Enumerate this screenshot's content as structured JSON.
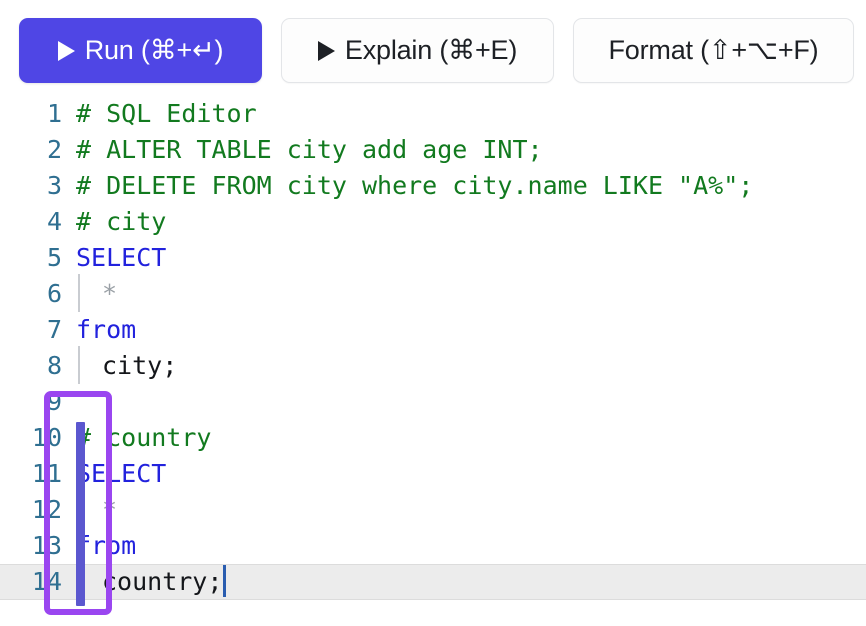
{
  "toolbar": {
    "run": {
      "label": "Run (⌘+↵)",
      "icon": "play-triangle-icon",
      "accent": "#4f46e5"
    },
    "explain": {
      "label": "Explain (⌘+E)",
      "icon": "play-triangle-icon"
    },
    "format": {
      "label": "Format (⇧+⌥+F)"
    }
  },
  "editor": {
    "language": "sql",
    "active_line": 14,
    "cursor_line": 14,
    "cursor_column": 11,
    "colors": {
      "comment": "#127a1f",
      "keyword": "#2222dd",
      "operator": "#9aa0a6",
      "plain": "#14161a",
      "line_number": "#2f6f91",
      "active_line_bg": "#ececec",
      "caret": "#2a5db0",
      "change_bar": "#5b57cf",
      "annotation": "#9a46f0"
    },
    "lines": [
      {
        "n": "1",
        "text": "# SQL Editor"
      },
      {
        "n": "2",
        "text": "# ALTER TABLE city add age INT;"
      },
      {
        "n": "3",
        "text": "# DELETE FROM city where city.name LIKE \"A%\";"
      },
      {
        "n": "4",
        "text": "# city"
      },
      {
        "n": "5",
        "text": "SELECT"
      },
      {
        "n": "6",
        "text": "  *"
      },
      {
        "n": "7",
        "text": "from"
      },
      {
        "n": "8",
        "text": "  city;"
      },
      {
        "n": "9",
        "text": ""
      },
      {
        "n": "10",
        "text": "# country"
      },
      {
        "n": "11",
        "text": "SELECT"
      },
      {
        "n": "12",
        "text": "  *"
      },
      {
        "n": "13",
        "text": "from"
      },
      {
        "n": "14",
        "text": "  country;"
      }
    ],
    "tokens": {
      "l1_comment": "# SQL Editor",
      "l2_comment": "# ALTER TABLE city add age INT;",
      "l3_comment": "# DELETE FROM city where city.name LIKE \"A%\";",
      "l4_comment": "# city",
      "l5_keyword": "SELECT",
      "l6_star": "*",
      "l7_keyword": "from",
      "l8_plain": "city;",
      "l9_empty": "",
      "l10_comment": "# country",
      "l11_keyword": "SELECT",
      "l12_star": "*",
      "l13_keyword": "from",
      "l14_plain": "country;"
    }
  },
  "annotation": {
    "type": "highlight-rectangle",
    "covers_lines": "9-14",
    "color": "#9a46f0"
  }
}
